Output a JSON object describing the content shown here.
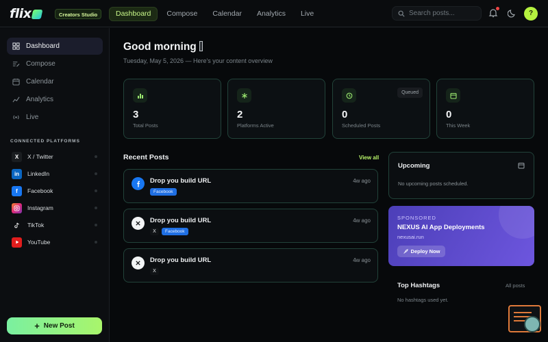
{
  "app": {
    "logo_text": "flix",
    "badge": "Creators Studio"
  },
  "nav": {
    "items": [
      {
        "label": "Dashboard",
        "active": true
      },
      {
        "label": "Compose"
      },
      {
        "label": "Calendar"
      },
      {
        "label": "Analytics"
      },
      {
        "label": "Live"
      }
    ]
  },
  "search": {
    "placeholder": "Search posts..."
  },
  "user": {
    "avatar_initial": "?"
  },
  "sidebar": {
    "items": [
      {
        "label": "Dashboard",
        "icon": "grid-icon",
        "active": true
      },
      {
        "label": "Compose",
        "icon": "compose-icon"
      },
      {
        "label": "Calendar",
        "icon": "calendar-icon"
      },
      {
        "label": "Analytics",
        "icon": "chart-icon"
      },
      {
        "label": "Live",
        "icon": "broadcast-icon"
      }
    ],
    "platforms_heading": "CONNECTED PLATFORMS",
    "platforms": [
      {
        "label": "X / Twitter",
        "color": "#1a1d20",
        "icon": "x-icon"
      },
      {
        "label": "LinkedIn",
        "color": "#0a66c2",
        "icon": "linkedin-icon"
      },
      {
        "label": "Facebook",
        "color": "#1877f2",
        "icon": "facebook-icon"
      },
      {
        "label": "Instagram",
        "color": "#e1306c",
        "icon": "instagram-icon"
      },
      {
        "label": "TikTok",
        "color": "#111111",
        "icon": "tiktok-icon"
      },
      {
        "label": "YouTube",
        "color": "#ff0000",
        "icon": "youtube-icon"
      }
    ],
    "new_post_label": "New Post"
  },
  "main": {
    "greeting": "Good morning",
    "subtitle": "Tuesday, May 5, 2026 — Here's your content overview",
    "stats": [
      {
        "value": "3",
        "label": "Total Posts",
        "icon": "bar-chart-icon"
      },
      {
        "value": "2",
        "label": "Platforms Active",
        "icon": "network-icon"
      },
      {
        "value": "0",
        "label": "Scheduled Posts",
        "icon": "clock-icon",
        "badge": "Queued"
      },
      {
        "value": "0",
        "label": "This Week",
        "icon": "calendar-icon"
      }
    ],
    "recent_posts_title": "Recent Posts",
    "view_all": "View all",
    "posts": [
      {
        "title": "Drop you build URL",
        "time": "4w ago",
        "platform_icon": "facebook-icon",
        "tags": [
          "Facebook"
        ]
      },
      {
        "title": "Drop you build URL",
        "time": "4w ago",
        "platform_icon": "x-icon",
        "tags": [
          "X",
          "Facebook"
        ]
      },
      {
        "title": "Drop you build URL",
        "time": "4w ago",
        "platform_icon": "x-icon",
        "tags": [
          "X"
        ]
      }
    ],
    "upcoming": {
      "title": "Upcoming",
      "empty": "No upcoming posts scheduled."
    },
    "sponsor": {
      "label": "SPONSORED",
      "title": "NEXUS AI App Deployments",
      "url": "nexusai.run",
      "button": "Deploy Now"
    },
    "hashtags": {
      "title": "Top Hashtags",
      "all_posts": "All posts",
      "empty": "No hashtags used yet."
    }
  },
  "colors": {
    "accent": "#b9f56a",
    "card_border": "#22433a",
    "sponsor": "#5b4ad0"
  }
}
